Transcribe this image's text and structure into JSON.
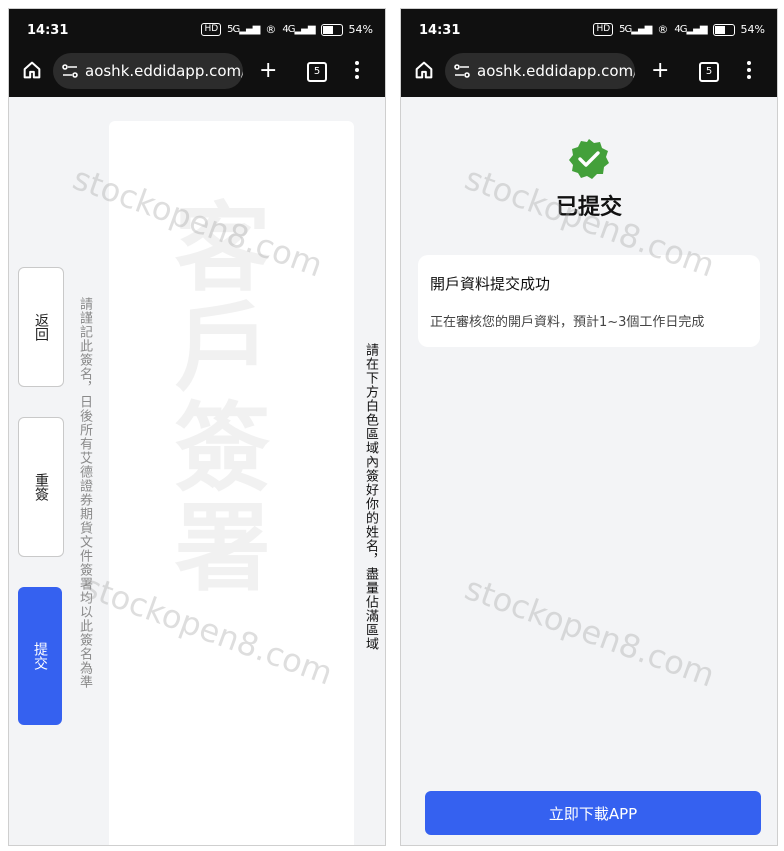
{
  "status_bar": {
    "time": "14:31",
    "hd_badge": "HD",
    "network_5g": "5G",
    "network_4g": "4G",
    "battery": "54",
    "battery_unit": "%"
  },
  "browser": {
    "left_url": "aoshk.eddidapp.com/s",
    "right_url": "aoshk.eddidapp.com/a",
    "tab_count": "5",
    "new_tab_icon": "+"
  },
  "signature_page": {
    "back_label": "返回",
    "redo_label": "重簽",
    "submit_label": "提交",
    "remember_hint": "請謹記此簽名，日後所有艾德證券期貨文件簽署均以此簽名為準",
    "instruction": "請在下方白色區域內簽好你的姓名，盡量佔滿區域",
    "area_watermark": "客戶簽署"
  },
  "result_page": {
    "title": "已提交",
    "card_title": "開戶資料提交成功",
    "card_desc": "正在審核您的開戶資料，預計1~3個工作日完成",
    "download_label": "立即下載APP"
  },
  "watermark": {
    "text": "stockopen8.com"
  },
  "colors": {
    "accent": "#3561f0",
    "success": "#43a03a",
    "topbar": "#101010"
  }
}
